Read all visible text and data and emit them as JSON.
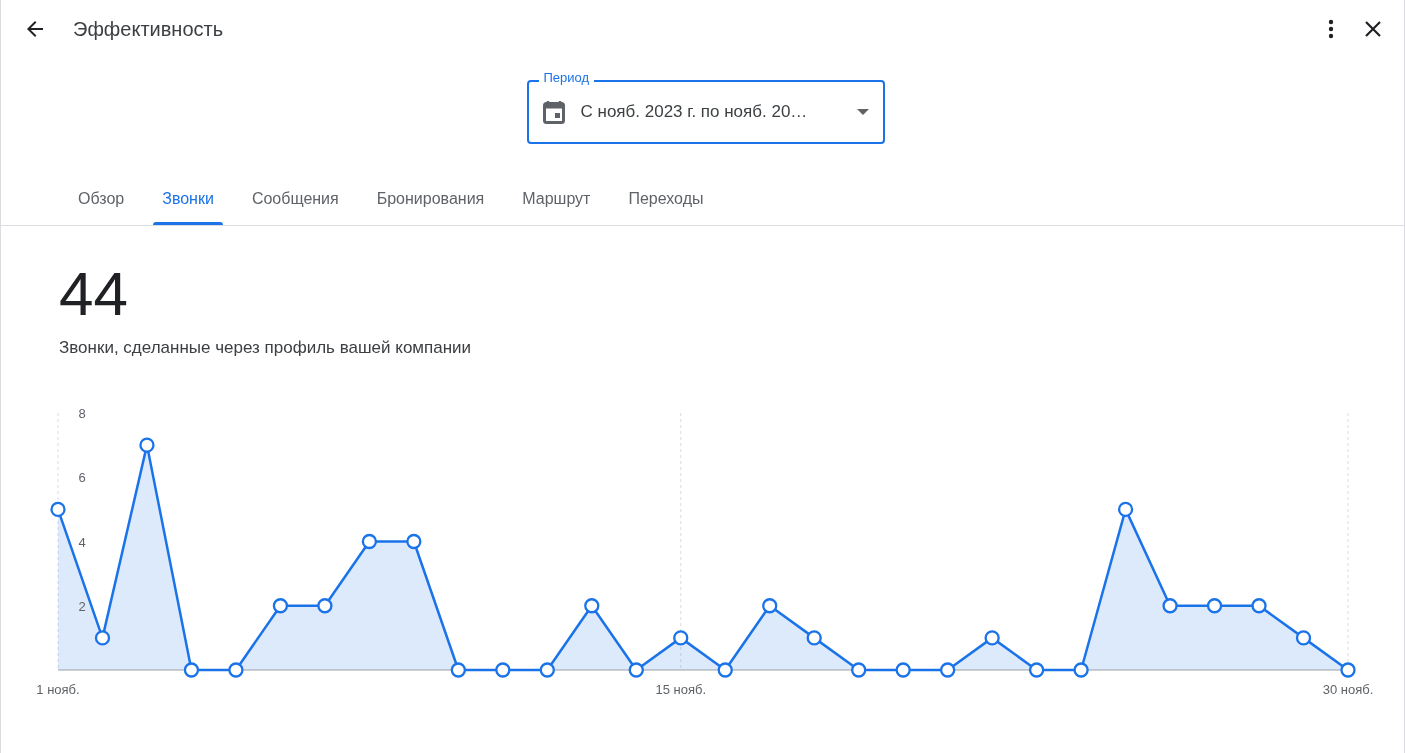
{
  "header": {
    "title": "Эффективность"
  },
  "period": {
    "label": "Период",
    "value": "С нояб. 2023 г. по нояб. 20…"
  },
  "tabs": [
    {
      "label": "Обзор",
      "selected": false
    },
    {
      "label": "Звонки",
      "selected": true
    },
    {
      "label": "Сообщения",
      "selected": false
    },
    {
      "label": "Бронирования",
      "selected": false
    },
    {
      "label": "Маршрут",
      "selected": false
    },
    {
      "label": "Переходы",
      "selected": false
    }
  ],
  "summary": {
    "value": "44",
    "caption": "Звонки, сделанные через профиль вашей компании"
  },
  "chart_data": {
    "type": "area",
    "x": [
      1,
      2,
      3,
      4,
      5,
      6,
      7,
      8,
      9,
      10,
      11,
      12,
      13,
      14,
      15,
      16,
      17,
      18,
      19,
      20,
      21,
      22,
      23,
      24,
      25,
      26,
      27,
      28,
      29,
      30
    ],
    "xticks": [
      {
        "value": 1,
        "label": "1 нояб."
      },
      {
        "value": 15,
        "label": "15 нояб."
      },
      {
        "value": 30,
        "label": "30 нояб."
      }
    ],
    "xlim": [
      1,
      30
    ],
    "ylim": [
      0,
      8
    ],
    "yticks": [
      2,
      4,
      6,
      8
    ],
    "series": [
      {
        "color": "#1a73e8",
        "values": [
          5,
          1,
          7,
          0,
          0,
          2,
          2,
          4,
          4,
          0,
          0,
          0,
          2,
          0,
          1,
          0,
          2,
          1,
          0,
          0,
          0,
          1,
          0,
          0,
          5,
          2,
          2,
          2,
          1,
          0
        ]
      }
    ]
  }
}
